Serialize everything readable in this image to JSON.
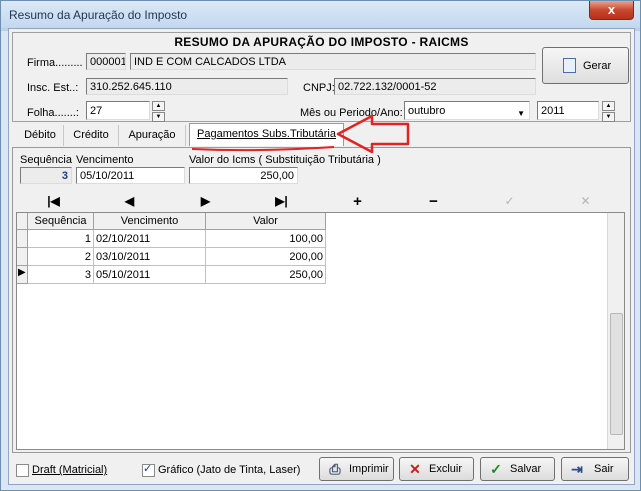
{
  "window": {
    "title": "Resumo da Apuração do Imposto",
    "close_glyph": "x"
  },
  "header": {
    "form_title": "RESUMO DA APURAÇÃO DO IMPOSTO - RAICMS",
    "firma_label": "Firma.........",
    "firma_code": "000001",
    "firma_name": "IND E COM CALCADOS LTDA",
    "insc_label": "Insc. Est..:",
    "insc_value": "310.252.645.110",
    "cnpj_label": "CNPJ:",
    "cnpj_value": "02.722.132/0001-52",
    "folha_label": "Folha.......:",
    "folha_value": "27",
    "periodo_label": "Mês ou Periodo/Ano:",
    "periodo_value": "outubro",
    "ano_value": "2011",
    "gerar_label": "Gerar"
  },
  "tabs": [
    {
      "label": "Débito"
    },
    {
      "label": "Crédito"
    },
    {
      "label": "Apuração"
    },
    {
      "label": "Pagamentos Subs.Tributária"
    }
  ],
  "detail": {
    "sequencia_label": "Sequência",
    "sequencia_value": "3",
    "vencimento_label": "Vencimento",
    "vencimento_value": "05/10/2011",
    "valor_label": "Valor do Icms ( Substituição Tributária )",
    "valor_value": "250,00"
  },
  "navigator": {
    "first": "|◀",
    "prior": "◀",
    "next": "▶",
    "last": "▶|",
    "insert": "+",
    "delete": "−",
    "post": "✓",
    "cancel": "✕"
  },
  "grid": {
    "columns": [
      "Sequência",
      "Vencimento",
      "Valor"
    ],
    "rows": [
      {
        "seq": "1",
        "venc": "02/10/2011",
        "valor": "100,00"
      },
      {
        "seq": "2",
        "venc": "03/10/2011",
        "valor": "200,00"
      },
      {
        "seq": "3",
        "venc": "05/10/2011",
        "valor": "250,00"
      }
    ]
  },
  "footer": {
    "draft_label": "Draft (Matricial)",
    "draft_checked": false,
    "grafico_label": "Gráfico (Jato de Tinta, Laser)",
    "grafico_checked": true,
    "imprimir_label": "Imprimir",
    "excluir_label": "Excluir",
    "salvar_label": "Salvar",
    "sair_label": "Sair"
  },
  "annotation": {
    "color": "#e32222"
  }
}
